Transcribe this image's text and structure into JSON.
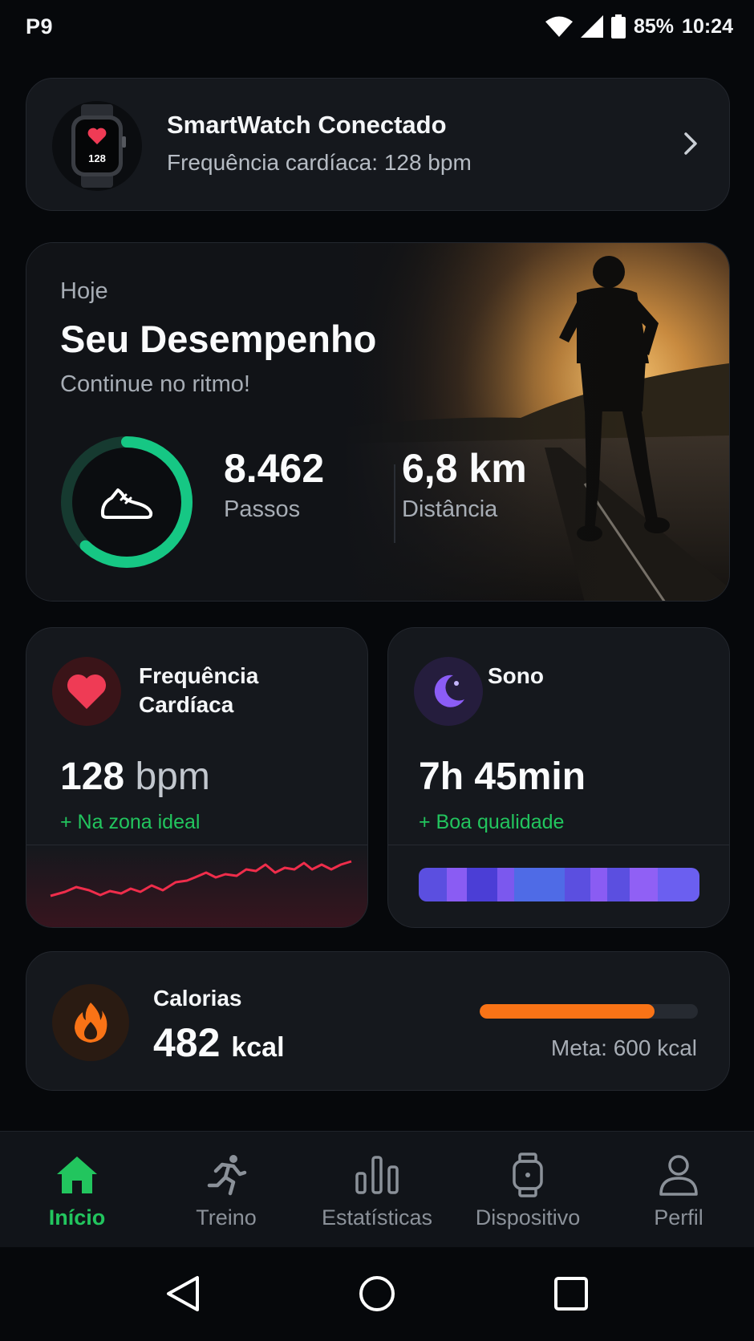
{
  "status_bar": {
    "carrier": "P9",
    "battery": "85%",
    "time": "10:24",
    "icons": [
      "wifi-icon",
      "signal-icon",
      "battery-icon"
    ]
  },
  "watch": {
    "title": "SmartWatch Conectado",
    "subtitle": "Frequência cardíaca: 128 bpm",
    "watch_face_value": "128",
    "icons": [
      "smartwatch-icon",
      "chevron-right-icon"
    ]
  },
  "performance": {
    "label": "Hoje",
    "title": "Seu Desempenho",
    "subtitle": "Continue no ritmo!",
    "steps_value": "8.462",
    "steps_label": "Passos",
    "distance_value": "6,8 km",
    "distance_label": "Distância",
    "ring_progress": 0.62,
    "icons": [
      "shoe-icon",
      "runner-photo"
    ]
  },
  "heart_rate": {
    "title_line1": "Frequência",
    "title_line2": "Cardíaca",
    "value": "128",
    "unit": "bpm",
    "status": "+ Na zona ideal",
    "icon": "heart-icon"
  },
  "sleep": {
    "title": "Sono",
    "value": "7h 45min",
    "status": "+ Boa qualidade",
    "icon": "moon-icon"
  },
  "calories": {
    "title": "Calorias",
    "value": "482",
    "unit": "kcal",
    "goal": "Meta: 600 kcal",
    "progress": 0.8,
    "icon": "flame-icon"
  },
  "nav": {
    "items": [
      {
        "label": "Início",
        "icon": "home-icon",
        "active": true
      },
      {
        "label": "Treino",
        "icon": "runner-icon"
      },
      {
        "label": "Estatísticas",
        "icon": "bar-chart-icon"
      },
      {
        "label": "Dispositivo",
        "icon": "watch-icon"
      },
      {
        "label": "Perfil",
        "icon": "user-icon"
      }
    ]
  },
  "colors": {
    "accent_green": "#22c55e",
    "heart_red": "#ef3b55",
    "sleep_purple": "#8b5cf6",
    "calorie_orange": "#f97316"
  }
}
